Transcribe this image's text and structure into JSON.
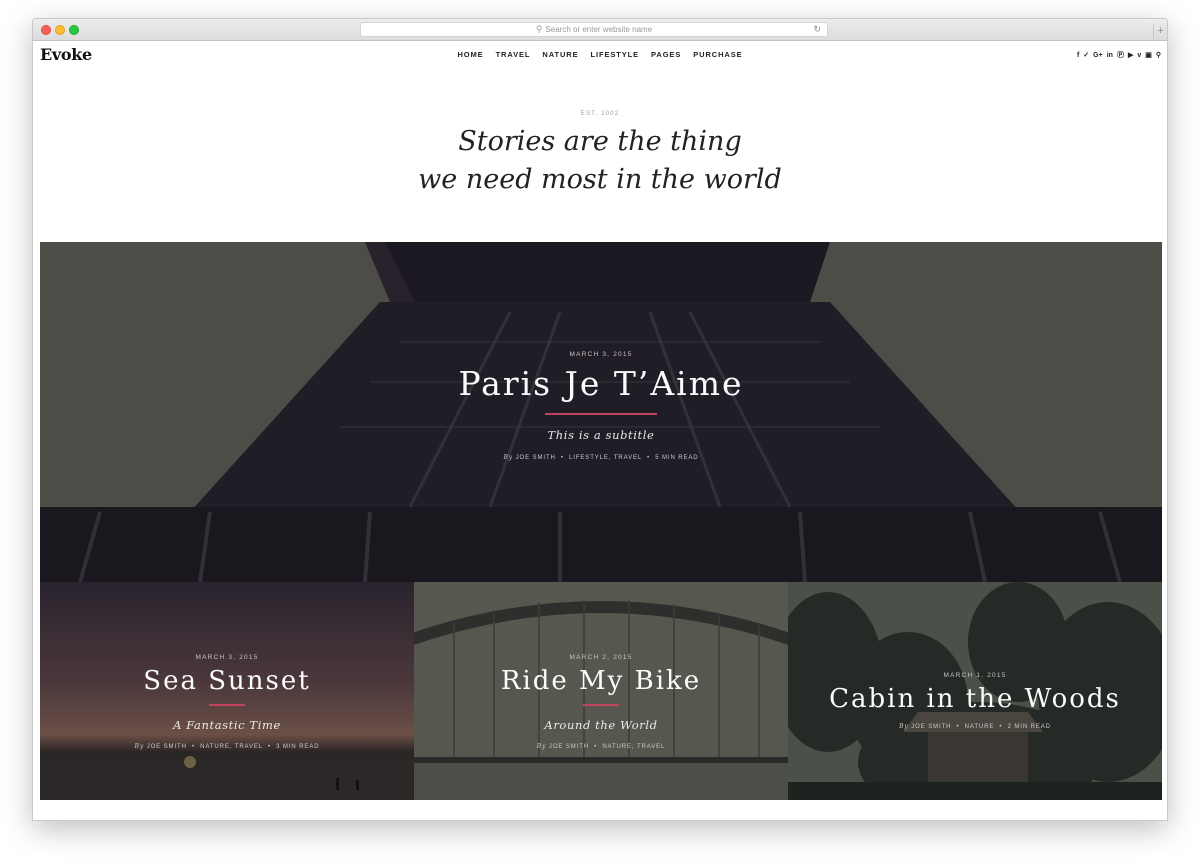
{
  "browser": {
    "address_placeholder": "Search or enter website name",
    "new_tab_label": "+"
  },
  "site": {
    "logo": "Evoke",
    "nav": [
      "HOME",
      "TRAVEL",
      "NATURE",
      "LIFESTYLE",
      "PAGES",
      "PURCHASE"
    ],
    "social_icons": [
      "facebook-icon",
      "twitter-icon",
      "google-plus-icon",
      "linkedin-icon",
      "pinterest-icon",
      "youtube-icon",
      "vimeo-icon",
      "instagram-icon"
    ],
    "est": "EST. 2002",
    "tagline_line1": "Stories are the thing",
    "tagline_line2": "we need most in the world"
  },
  "hero": {
    "date": "MARCH 3, 2015",
    "title": "Paris Je T’Aime",
    "subtitle": "This is a subtitle",
    "by": "By",
    "author": "JOE SMITH",
    "categories": "LIFESTYLE, TRAVEL",
    "read": "5 MIN READ"
  },
  "cards": [
    {
      "date": "MARCH 3, 2015",
      "title": "Sea Sunset",
      "subtitle": "A Fantastic Time",
      "by": "By",
      "author": "JOE SMITH",
      "categories": "NATURE, TRAVEL",
      "read": "3 MIN READ"
    },
    {
      "date": "MARCH 2, 2015",
      "title": "Ride My Bike",
      "subtitle": "Around the World",
      "by": "By",
      "author": "JOE SMITH",
      "categories": "NATURE, TRAVEL",
      "read": ""
    },
    {
      "date": "MARCH 1, 2015",
      "title": "Cabin in the Woods",
      "subtitle": "",
      "by": "By",
      "author": "JOE SMITH",
      "categories": "NATURE",
      "read": "2 MIN READ"
    }
  ],
  "colors": {
    "accent_rule": "#c2435c",
    "hero_bg": "#5b5b54"
  }
}
